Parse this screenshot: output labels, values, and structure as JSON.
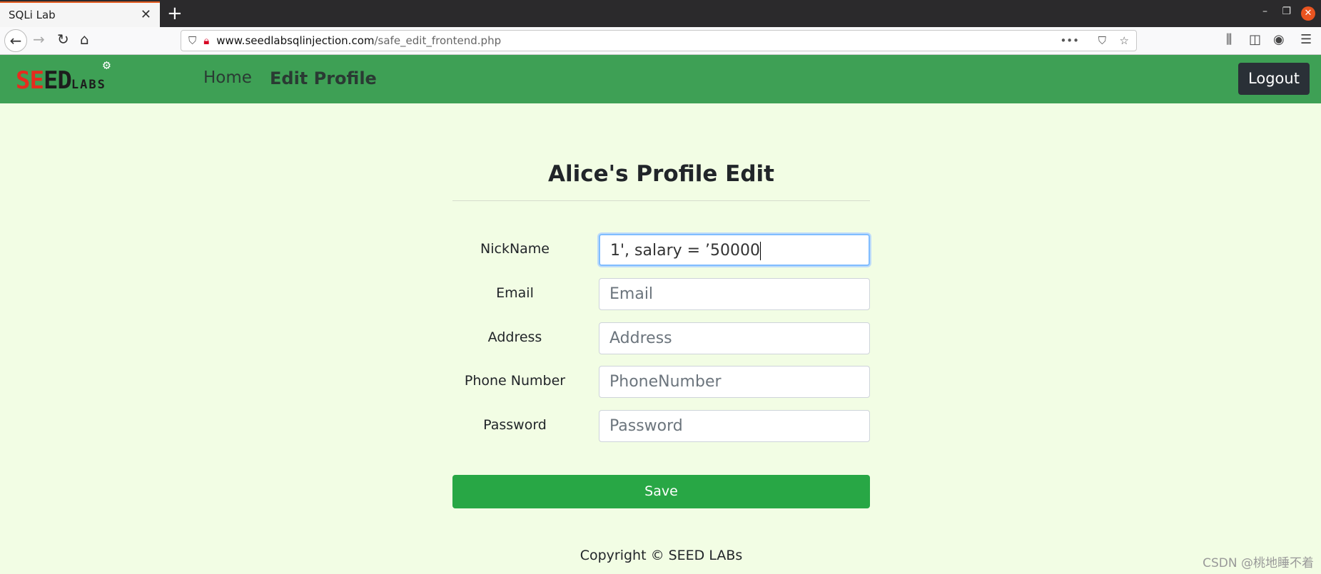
{
  "browser": {
    "tab_title": "SQLi Lab",
    "url_domain": "www.seedlabsqlinjection.com",
    "url_path": "/safe_edit_frontend.php"
  },
  "nav": {
    "logo_text": "SEED LABs",
    "home": "Home",
    "edit_profile": "Edit Profile",
    "logout": "Logout",
    "brand_color": "#3ea055"
  },
  "form": {
    "title": "Alice's Profile Edit",
    "fields": [
      {
        "label": "NickName",
        "value": "1', salary = ’50000",
        "placeholder": ""
      },
      {
        "label": "Email",
        "value": "",
        "placeholder": "Email"
      },
      {
        "label": "Address",
        "value": "",
        "placeholder": "Address"
      },
      {
        "label": "Phone Number",
        "value": "",
        "placeholder": "PhoneNumber"
      },
      {
        "label": "Password",
        "value": "",
        "placeholder": "Password"
      }
    ],
    "save": "Save"
  },
  "footer": {
    "copyright": "Copyright © SEED LABs"
  },
  "watermark": "CSDN @桃地睡不着"
}
